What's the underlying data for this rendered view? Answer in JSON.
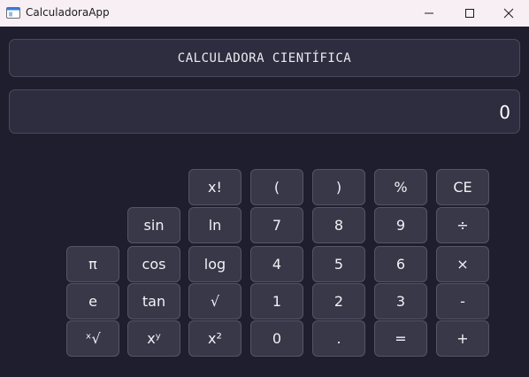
{
  "window": {
    "title": "CalculadoraApp",
    "controls": {
      "minimize": "minimize",
      "maximize": "maximize",
      "close": "close"
    }
  },
  "header": {
    "title": "CALCULADORA CIENTÍFICA"
  },
  "display": {
    "value": "0"
  },
  "keys": {
    "factorial": "x!",
    "paren_open": "(",
    "paren_close": ")",
    "percent": "%",
    "clear_entry": "CE",
    "sin": "sin",
    "ln": "ln",
    "digit_7": "7",
    "digit_8": "8",
    "digit_9": "9",
    "divide": "÷",
    "pi": "π",
    "cos": "cos",
    "log": "log",
    "digit_4": "4",
    "digit_5": "5",
    "digit_6": "6",
    "multiply": "×",
    "e": "e",
    "tan": "tan",
    "sqrt": "√",
    "digit_1": "1",
    "digit_2": "2",
    "digit_3": "3",
    "subtract": "-",
    "nth_root": "ˣ√",
    "power": "xʸ",
    "square": "x²",
    "digit_0": "0",
    "decimal": ".",
    "equals": "=",
    "add": "+"
  },
  "colors": {
    "background": "#1f1e2e",
    "panel": "#2e2d3f",
    "key": "#383849",
    "titlebar": "#f8eff4"
  }
}
